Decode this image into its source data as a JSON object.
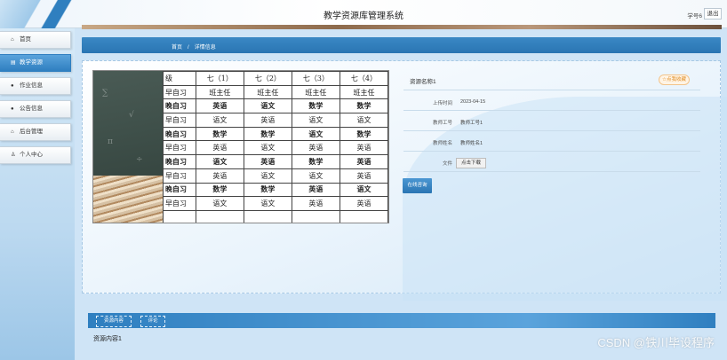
{
  "app_title": "教学资源库管理系统",
  "header": {
    "user": "学号6",
    "logout": "退出"
  },
  "sidebar": {
    "items": [
      {
        "icon": "home-icon",
        "glyph": "⌂",
        "label": "首页"
      },
      {
        "icon": "book-icon",
        "glyph": "▤",
        "label": "教学资源"
      },
      {
        "icon": "info-icon",
        "glyph": "●",
        "label": "作业信息"
      },
      {
        "icon": "help-icon",
        "glyph": "●",
        "label": "公告信息"
      },
      {
        "icon": "lock-icon",
        "glyph": "⌂",
        "label": "后台管理"
      },
      {
        "icon": "user-icon",
        "glyph": "♙",
        "label": "个人中心"
      }
    ],
    "active_index": 1
  },
  "breadcrumb": {
    "home": "首页",
    "sep": "/",
    "current": "详情信息"
  },
  "schedule": {
    "header": [
      "级",
      "七（1）",
      "七（2）",
      "七（3）",
      "七（4）"
    ],
    "rows": [
      {
        "bold": false,
        "cells": [
          "早自习",
          "班主任",
          "班主任",
          "班主任",
          "班主任"
        ]
      },
      {
        "bold": true,
        "cells": [
          "晚自习",
          "英语",
          "语文",
          "数学",
          "数学"
        ]
      },
      {
        "bold": false,
        "cells": [
          "早自习",
          "语文",
          "英语",
          "语文",
          "语文"
        ]
      },
      {
        "bold": true,
        "cells": [
          "晚自习",
          "数学",
          "数学",
          "语文",
          "数学"
        ]
      },
      {
        "bold": false,
        "cells": [
          "早自习",
          "英语",
          "语文",
          "英语",
          "英语"
        ]
      },
      {
        "bold": true,
        "cells": [
          "晚自习",
          "语文",
          "英语",
          "数学",
          "英语"
        ]
      },
      {
        "bold": false,
        "cells": [
          "早自习",
          "英语",
          "语文",
          "语文",
          "英语"
        ]
      },
      {
        "bold": true,
        "cells": [
          "晚自习",
          "数学",
          "数学",
          "英语",
          "语文"
        ]
      },
      {
        "bold": false,
        "cells": [
          "早自习",
          "语文",
          "语文",
          "英语",
          "英语"
        ]
      },
      {
        "bold": false,
        "cells": [
          "",
          "",
          "",
          "",
          ""
        ]
      }
    ]
  },
  "resource": {
    "name": "资源名称1",
    "favorite_button": "☆点我收藏",
    "fields": [
      {
        "label": "上传时间",
        "value": "2023-04-15"
      },
      {
        "label": "教师工号",
        "value": "教师工号1"
      },
      {
        "label": "教师姓名",
        "value": "教师姓名1"
      },
      {
        "label": "文件",
        "value": ""
      }
    ],
    "download_button": "点击下载",
    "consult_button": "在线咨询"
  },
  "tabs": [
    {
      "label": "资源内容"
    },
    {
      "label": "评论"
    }
  ],
  "content_text": "资源内容1",
  "watermark": "CSDN @铁川毕设程序"
}
